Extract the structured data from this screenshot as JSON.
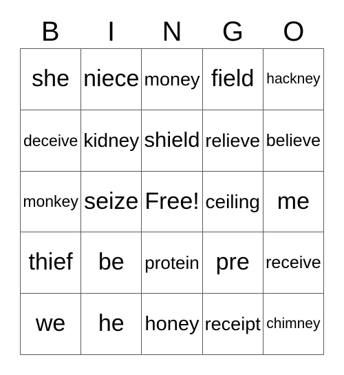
{
  "card": {
    "type": "bingo-card",
    "columns": 5,
    "rows": 5,
    "header": {
      "letters": [
        "B",
        "I",
        "N",
        "G",
        "O"
      ]
    },
    "free_space": {
      "label": "Free!",
      "row": 2,
      "column": 2
    },
    "colors": {
      "background": "#ffffff",
      "text": "#000000",
      "grid_line": "#5a5a5a"
    },
    "grid": [
      [
        {
          "text": "she"
        },
        {
          "text": "niece"
        },
        {
          "text": "money"
        },
        {
          "text": "field"
        },
        {
          "text": "hackney"
        }
      ],
      [
        {
          "text": "deceive"
        },
        {
          "text": "kidney"
        },
        {
          "text": "shield"
        },
        {
          "text": "relieve"
        },
        {
          "text": "believe"
        }
      ],
      [
        {
          "text": "monkey"
        },
        {
          "text": "seize"
        },
        {
          "text": "Free!"
        },
        {
          "text": "ceiling"
        },
        {
          "text": "me"
        }
      ],
      [
        {
          "text": "thief"
        },
        {
          "text": "be"
        },
        {
          "text": "protein"
        },
        {
          "text": "pre"
        },
        {
          "text": "receive"
        }
      ],
      [
        {
          "text": "we"
        },
        {
          "text": "he"
        },
        {
          "text": "honey"
        },
        {
          "text": "receipt"
        },
        {
          "text": "chimney"
        }
      ]
    ]
  }
}
